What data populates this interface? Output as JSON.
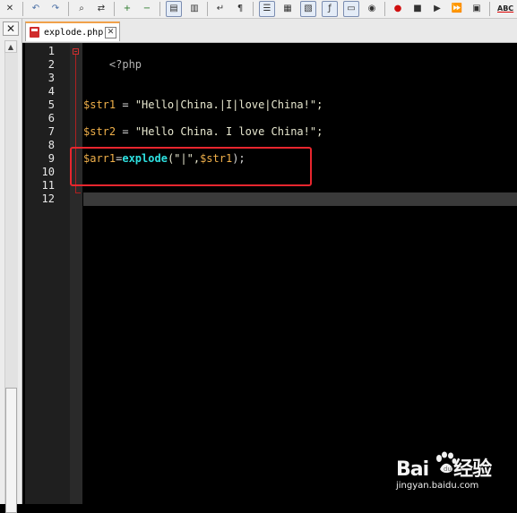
{
  "toolbar": {
    "buttons": [
      {
        "name": "close-doc-icon",
        "glyph": "✕"
      },
      {
        "name": "undo-icon",
        "glyph": "↶"
      },
      {
        "name": "redo-icon",
        "glyph": "↷"
      },
      {
        "name": "find-icon",
        "glyph": "⌕"
      },
      {
        "name": "replace-icon",
        "glyph": "⇄"
      },
      {
        "name": "zoom-in-icon",
        "glyph": "+"
      },
      {
        "name": "zoom-out-icon",
        "glyph": "−"
      },
      {
        "name": "sync-vertical-icon",
        "glyph": "▤"
      },
      {
        "name": "sync-horizontal-icon",
        "glyph": "▥"
      },
      {
        "name": "word-wrap-icon",
        "glyph": "↵"
      },
      {
        "name": "show-all-chars-icon",
        "glyph": "¶"
      },
      {
        "name": "indent-guide-icon",
        "glyph": "☰"
      },
      {
        "name": "user-lang-icon",
        "glyph": "▦"
      },
      {
        "name": "doc-map-icon",
        "glyph": "▧"
      },
      {
        "name": "function-list-icon",
        "glyph": "ƒ"
      },
      {
        "name": "folder-workspace-icon",
        "glyph": "▭"
      },
      {
        "name": "monitoring-icon",
        "glyph": "◉"
      },
      {
        "name": "record-macro-icon",
        "glyph": "●"
      },
      {
        "name": "stop-macro-icon",
        "glyph": "■"
      },
      {
        "name": "play-macro-icon",
        "glyph": "▶"
      },
      {
        "name": "run-macro-multiple-icon",
        "glyph": "⏩"
      },
      {
        "name": "save-macro-icon",
        "glyph": "▣"
      }
    ],
    "spellcheck_label": "ABC"
  },
  "tab": {
    "label": "explode.php",
    "close_glyph": "✕"
  },
  "left_panel": {
    "close_glyph": "✕",
    "scroll_up_glyph": "▲"
  },
  "editor": {
    "line_numbers": [
      "1",
      "2",
      "3",
      "4",
      "5",
      "6",
      "7",
      "8",
      "9",
      "10",
      "11",
      "12"
    ],
    "lines": {
      "l1": "<?php",
      "l5_var": "$str1",
      "l5_op": " = ",
      "l5_str": "\"Hello|China.|I|love|China!\";",
      "l7_var": "$str2",
      "l7_op": " = ",
      "l7_str": "\"Hello China. I love China!\";",
      "l9_var": "$arr1",
      "l9_op": "=",
      "l9_fn": "explode",
      "l9_rest": "(\"|\",",
      "l9_var2": "$str1",
      "l9_end": ");"
    },
    "current_line": 12,
    "highlight_color": "#e8262e"
  },
  "watermark": {
    "brand": "Bai",
    "brand2": "经验",
    "url": "jingyan.baidu.com"
  }
}
